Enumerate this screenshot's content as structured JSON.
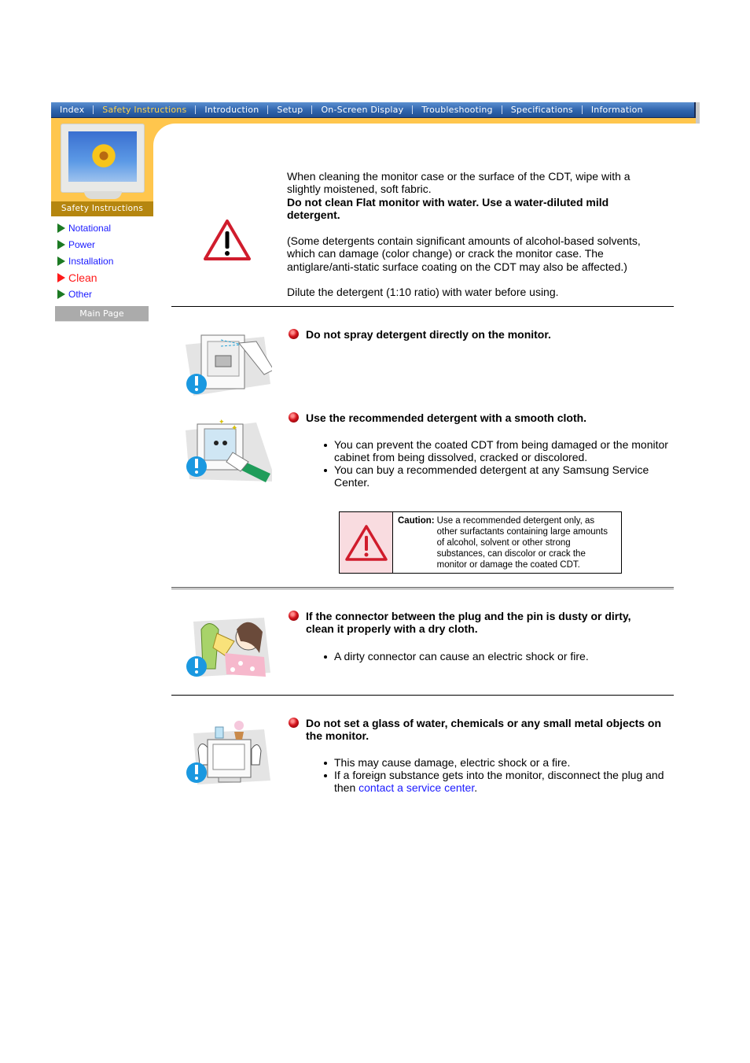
{
  "nav": {
    "items": [
      {
        "label": "Index",
        "active": false
      },
      {
        "label": "Safety Instructions",
        "active": true
      },
      {
        "label": "Introduction",
        "active": false
      },
      {
        "label": "Setup",
        "active": false
      },
      {
        "label": "On-Screen Display",
        "active": false
      },
      {
        "label": "Troubleshooting",
        "active": false
      },
      {
        "label": "Specifications",
        "active": false
      },
      {
        "label": "Information",
        "active": false
      }
    ]
  },
  "sidebar": {
    "section_title": "Safety Instructions",
    "items": [
      {
        "label": "Notational",
        "active": false
      },
      {
        "label": "Power",
        "active": false
      },
      {
        "label": "Installation",
        "active": false
      },
      {
        "label": "Clean",
        "active": true
      },
      {
        "label": "Other",
        "active": false
      }
    ],
    "main_page_label": "Main Page"
  },
  "intro": {
    "line1": "When cleaning the monitor case or the surface of the CDT, wipe with a slightly moistened, soft fabric.",
    "bold": "Do not clean Flat monitor with water. Use a water-diluted mild detergent.",
    "paren": "(Some detergents contain significant amounts of alcohol-based solvents, which can damage (color change) or crack the monitor case. The antiglare/anti-static surface coating on the CDT may also be affected.)",
    "dilute": "Dilute the detergent (1:10 ratio) with water before using."
  },
  "items": [
    {
      "heading": "Do not spray detergent directly on the monitor.",
      "bullets": []
    },
    {
      "heading": "Use the recommended detergent with a smooth cloth.",
      "bullets": [
        "You can prevent the coated CDT from being damaged or the monitor cabinet from being dissolved, cracked or discolored.",
        "You can buy a recommended detergent at any Samsung Service Center."
      ]
    },
    {
      "heading": "If the connector between the plug and the pin is dusty or dirty, clean it properly with a dry cloth.",
      "bullets": [
        "A dirty connector can cause an electric shock or fire."
      ]
    },
    {
      "heading": "Do not set a glass of water, chemicals or any small metal objects on the monitor.",
      "bullets": [
        "This may cause damage, electric shock or a fire.",
        "If a foreign substance gets into the monitor, disconnect the plug and then"
      ],
      "link": "contact a service center",
      "link_suffix": "."
    }
  ],
  "caution": {
    "label": "Caution:",
    "text": "Use a recommended detergent only, as other surfactants containing large amounts of alcohol, solvent or other strong substances, can discolor or crack the monitor or damage the coated CDT."
  }
}
